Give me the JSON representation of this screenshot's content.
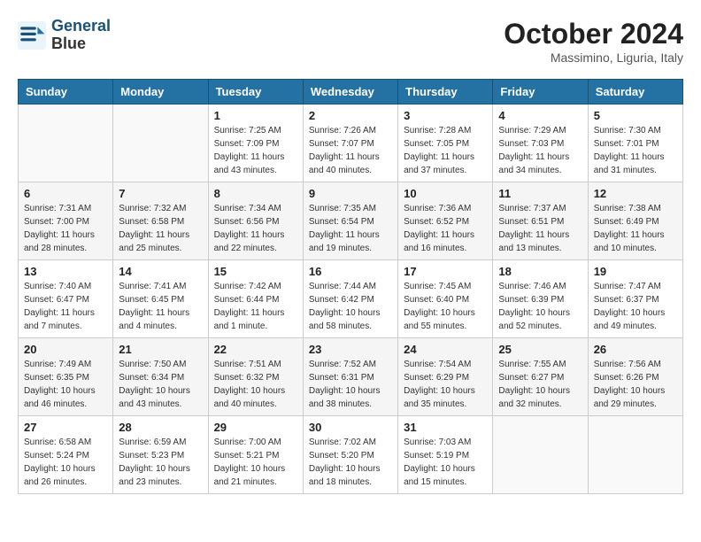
{
  "header": {
    "logo_line1": "General",
    "logo_line2": "Blue",
    "month": "October 2024",
    "location": "Massimino, Liguria, Italy"
  },
  "weekdays": [
    "Sunday",
    "Monday",
    "Tuesday",
    "Wednesday",
    "Thursday",
    "Friday",
    "Saturday"
  ],
  "weeks": [
    [
      {
        "day": "",
        "info": ""
      },
      {
        "day": "",
        "info": ""
      },
      {
        "day": "1",
        "info": "Sunrise: 7:25 AM\nSunset: 7:09 PM\nDaylight: 11 hours and 43 minutes."
      },
      {
        "day": "2",
        "info": "Sunrise: 7:26 AM\nSunset: 7:07 PM\nDaylight: 11 hours and 40 minutes."
      },
      {
        "day": "3",
        "info": "Sunrise: 7:28 AM\nSunset: 7:05 PM\nDaylight: 11 hours and 37 minutes."
      },
      {
        "day": "4",
        "info": "Sunrise: 7:29 AM\nSunset: 7:03 PM\nDaylight: 11 hours and 34 minutes."
      },
      {
        "day": "5",
        "info": "Sunrise: 7:30 AM\nSunset: 7:01 PM\nDaylight: 11 hours and 31 minutes."
      }
    ],
    [
      {
        "day": "6",
        "info": "Sunrise: 7:31 AM\nSunset: 7:00 PM\nDaylight: 11 hours and 28 minutes."
      },
      {
        "day": "7",
        "info": "Sunrise: 7:32 AM\nSunset: 6:58 PM\nDaylight: 11 hours and 25 minutes."
      },
      {
        "day": "8",
        "info": "Sunrise: 7:34 AM\nSunset: 6:56 PM\nDaylight: 11 hours and 22 minutes."
      },
      {
        "day": "9",
        "info": "Sunrise: 7:35 AM\nSunset: 6:54 PM\nDaylight: 11 hours and 19 minutes."
      },
      {
        "day": "10",
        "info": "Sunrise: 7:36 AM\nSunset: 6:52 PM\nDaylight: 11 hours and 16 minutes."
      },
      {
        "day": "11",
        "info": "Sunrise: 7:37 AM\nSunset: 6:51 PM\nDaylight: 11 hours and 13 minutes."
      },
      {
        "day": "12",
        "info": "Sunrise: 7:38 AM\nSunset: 6:49 PM\nDaylight: 11 hours and 10 minutes."
      }
    ],
    [
      {
        "day": "13",
        "info": "Sunrise: 7:40 AM\nSunset: 6:47 PM\nDaylight: 11 hours and 7 minutes."
      },
      {
        "day": "14",
        "info": "Sunrise: 7:41 AM\nSunset: 6:45 PM\nDaylight: 11 hours and 4 minutes."
      },
      {
        "day": "15",
        "info": "Sunrise: 7:42 AM\nSunset: 6:44 PM\nDaylight: 11 hours and 1 minute."
      },
      {
        "day": "16",
        "info": "Sunrise: 7:44 AM\nSunset: 6:42 PM\nDaylight: 10 hours and 58 minutes."
      },
      {
        "day": "17",
        "info": "Sunrise: 7:45 AM\nSunset: 6:40 PM\nDaylight: 10 hours and 55 minutes."
      },
      {
        "day": "18",
        "info": "Sunrise: 7:46 AM\nSunset: 6:39 PM\nDaylight: 10 hours and 52 minutes."
      },
      {
        "day": "19",
        "info": "Sunrise: 7:47 AM\nSunset: 6:37 PM\nDaylight: 10 hours and 49 minutes."
      }
    ],
    [
      {
        "day": "20",
        "info": "Sunrise: 7:49 AM\nSunset: 6:35 PM\nDaylight: 10 hours and 46 minutes."
      },
      {
        "day": "21",
        "info": "Sunrise: 7:50 AM\nSunset: 6:34 PM\nDaylight: 10 hours and 43 minutes."
      },
      {
        "day": "22",
        "info": "Sunrise: 7:51 AM\nSunset: 6:32 PM\nDaylight: 10 hours and 40 minutes."
      },
      {
        "day": "23",
        "info": "Sunrise: 7:52 AM\nSunset: 6:31 PM\nDaylight: 10 hours and 38 minutes."
      },
      {
        "day": "24",
        "info": "Sunrise: 7:54 AM\nSunset: 6:29 PM\nDaylight: 10 hours and 35 minutes."
      },
      {
        "day": "25",
        "info": "Sunrise: 7:55 AM\nSunset: 6:27 PM\nDaylight: 10 hours and 32 minutes."
      },
      {
        "day": "26",
        "info": "Sunrise: 7:56 AM\nSunset: 6:26 PM\nDaylight: 10 hours and 29 minutes."
      }
    ],
    [
      {
        "day": "27",
        "info": "Sunrise: 6:58 AM\nSunset: 5:24 PM\nDaylight: 10 hours and 26 minutes."
      },
      {
        "day": "28",
        "info": "Sunrise: 6:59 AM\nSunset: 5:23 PM\nDaylight: 10 hours and 23 minutes."
      },
      {
        "day": "29",
        "info": "Sunrise: 7:00 AM\nSunset: 5:21 PM\nDaylight: 10 hours and 21 minutes."
      },
      {
        "day": "30",
        "info": "Sunrise: 7:02 AM\nSunset: 5:20 PM\nDaylight: 10 hours and 18 minutes."
      },
      {
        "day": "31",
        "info": "Sunrise: 7:03 AM\nSunset: 5:19 PM\nDaylight: 10 hours and 15 minutes."
      },
      {
        "day": "",
        "info": ""
      },
      {
        "day": "",
        "info": ""
      }
    ]
  ]
}
